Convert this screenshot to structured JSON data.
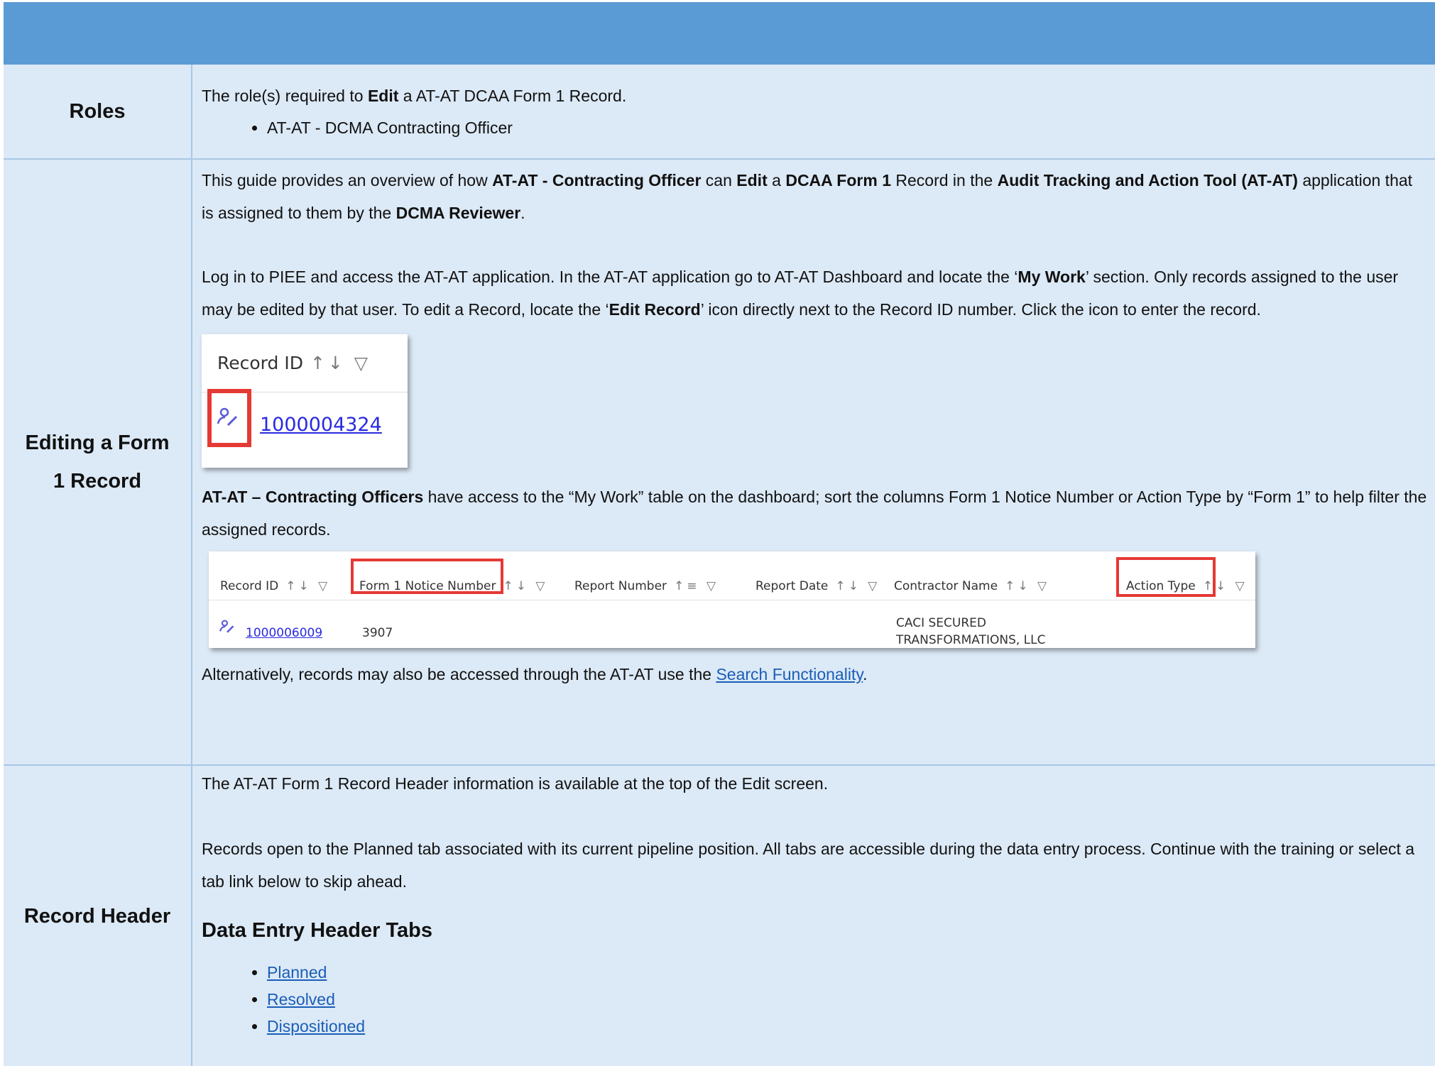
{
  "roles_row": {
    "label": "Roles",
    "intro_pre": "The role(s) required to ",
    "intro_bold": "Edit",
    "intro_post": " a AT-AT DCAA Form 1 Record.",
    "roles": [
      "AT-AT - DCMA Contracting Officer"
    ]
  },
  "editing_row": {
    "label_line1": "Editing a Form",
    "label_line2": "1 Record",
    "p1": {
      "t1": "This guide provides an overview of how ",
      "b1": "AT-AT - Contracting Officer",
      "t2": " can ",
      "b2": "Edit",
      "t3": " a ",
      "b3": "DCAA Form 1",
      "t4": " Record in the ",
      "b4": "Audit Tracking and Action Tool (AT-AT)",
      "t5": " application that is assigned to them by the ",
      "b5": "DCMA Reviewer",
      "t6": "."
    },
    "p2": {
      "t1": "Log in to PIEE and access the AT-AT application. In the AT-AT application go to AT-AT Dashboard and locate the ‘",
      "b1": "My Work",
      "t2": "’ section. Only records assigned to the user may be edited by that user. To edit a Record, locate the ‘",
      "b2": "Edit Record",
      "t3": "’ icon directly next to the Record ID number. Click the icon to enter the record."
    },
    "shot1": {
      "header": "Record ID",
      "sort_icons": "↑↓ ▽",
      "edit_icon": "edit-record-icon",
      "record_id": "1000004324"
    },
    "p3": {
      "b1": "AT-AT – Contracting Officers",
      "t1": " have access to the “My Work” table on the dashboard; sort the columns Form 1 Notice Number or Action Type by “Form 1” to help filter the assigned records."
    },
    "shot2": {
      "columns": [
        "Record ID",
        "Form 1 Notice Number",
        "Report Number",
        "Report Date",
        "Contractor Name",
        "Action Type"
      ],
      "sort_icons": "↑↓ ▽",
      "sort_icons_alt": "↑≡ ▽",
      "row": {
        "record_id": "1000006009",
        "notice_number": "3907",
        "contractor_line1": "CACI SECURED",
        "contractor_line2": "TRANSFORMATIONS, LLC"
      }
    },
    "p4": {
      "t1": "Alternatively, records may also be accessed through the AT-AT use the ",
      "link": "Search Functionality",
      "t2": "."
    }
  },
  "header_row": {
    "label": "Record Header",
    "p1": "The AT-AT Form 1 Record Header information is available at the top of the Edit screen.",
    "p2": "Records open to the Planned tab associated with its current pipeline position. All tabs are accessible during the data entry process. Continue with the training or select a tab link below to skip ahead.",
    "subheading": "Data Entry Header Tabs",
    "tabs": [
      "Planned",
      "Resolved",
      "Dispositioned"
    ]
  },
  "colors": {
    "band": "#5b9bd5",
    "cell_bg": "#dce9f6",
    "border": "#a9c7e6",
    "link": "#1a5eb8",
    "highlight": "#e53935"
  }
}
